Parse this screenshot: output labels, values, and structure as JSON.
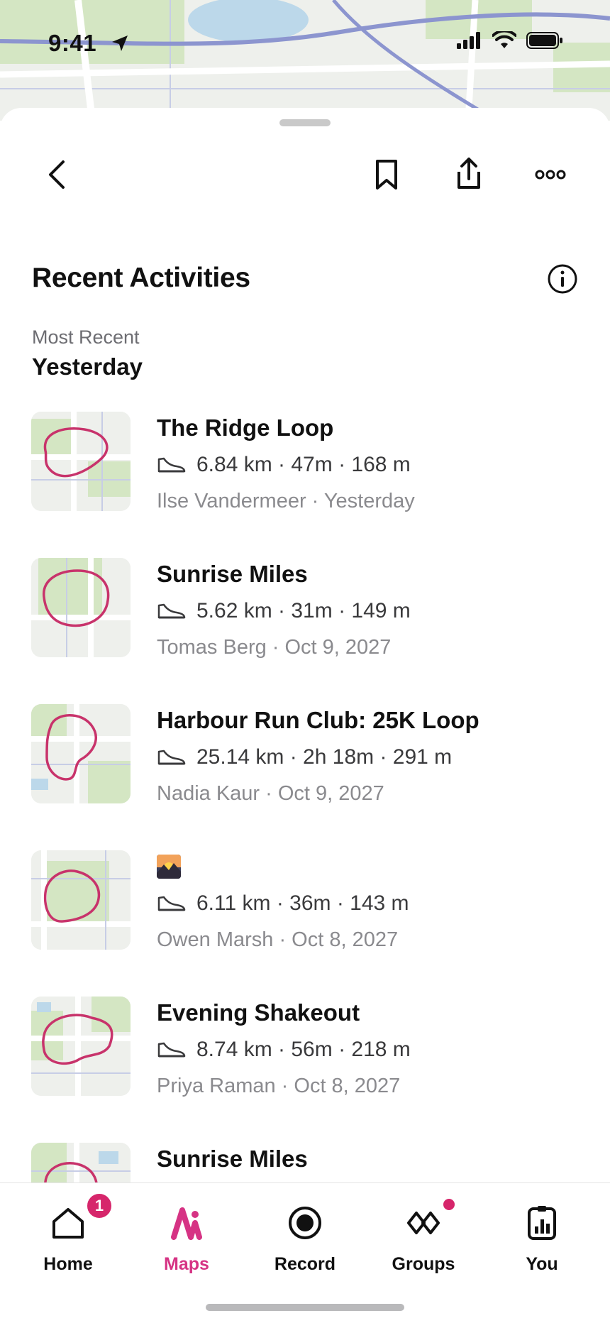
{
  "status_bar": {
    "time": "9:41"
  },
  "header": {
    "title": "Recent Activities",
    "section_subtitle": "Most Recent",
    "section_title": "Yesterday"
  },
  "activities": [
    {
      "title": "The Ridge Loop",
      "stats": "6.84 km · 47m · 168 m",
      "meta": "Ilse Vandermeer · Yesterday"
    },
    {
      "title": "Sunrise Miles",
      "stats": "5.62 km · 31m · 149 m",
      "meta": "Tomas Berg · Oct 9, 2027"
    },
    {
      "title": "Harbour Run Club: 25K Loop",
      "stats": "25.14 km · 2h 18m · 291 m",
      "meta": "Nadia Kaur · Oct 9, 2027"
    },
    {
      "title": "",
      "title_icon": "sunset-emoji",
      "stats": "6.11 km · 36m · 143 m",
      "meta": "Owen Marsh · Oct 8, 2027"
    },
    {
      "title": "Evening Shakeout",
      "stats": "8.74 km · 56m · 218 m",
      "meta": "Priya Raman · Oct 8, 2027"
    },
    {
      "title": "Sunrise Miles",
      "stats": "",
      "meta": ""
    }
  ],
  "tab_bar": {
    "tabs": [
      {
        "label": "Home",
        "badge": "1"
      },
      {
        "label": "Maps"
      },
      {
        "label": "Record"
      },
      {
        "label": "Groups"
      },
      {
        "label": "You"
      }
    ],
    "active": "Maps"
  },
  "colors": {
    "accent": "#d63384",
    "route": "#c8336b",
    "map_green": "#d4e6c3",
    "map_grid": "#b8c0e0"
  }
}
